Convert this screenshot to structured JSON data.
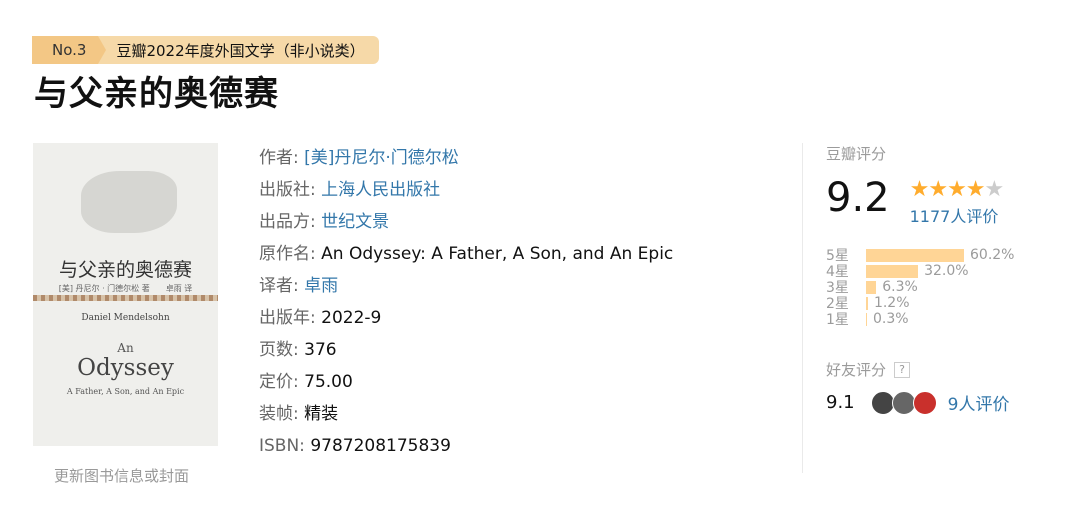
{
  "ranking": {
    "number": "No.3",
    "label": "豆瓣2022年度外国文学（非小说类）"
  },
  "book": {
    "title": "与父亲的奥德赛",
    "cover": {
      "title_cn": "与父亲的奥德赛",
      "author_line": "[美] 丹尼尔 · 门德尔松 著　　卓雨 译",
      "author_en": "Daniel Mendelsohn",
      "an": "An",
      "odyssey": "Odyssey",
      "subtitle": "A Father, A Son, and An Epic"
    },
    "update_link": "更新图书信息或封面"
  },
  "info": {
    "author": {
      "label": "作者:",
      "value": "[美]丹尼尔·门德尔松"
    },
    "publisher": {
      "label": "出版社:",
      "value": "上海人民出版社"
    },
    "producer": {
      "label": "出品方:",
      "value": "世纪文景"
    },
    "original_title": {
      "label": "原作名:",
      "value": "An Odyssey: A Father, A Son, and An Epic"
    },
    "translator": {
      "label": "译者:",
      "value": "卓雨"
    },
    "pub_year": {
      "label": "出版年:",
      "value": "2022-9"
    },
    "pages": {
      "label": "页数:",
      "value": "376"
    },
    "price": {
      "label": "定价:",
      "value": "75.00"
    },
    "binding": {
      "label": "装帧:",
      "value": "精装"
    },
    "isbn": {
      "label": "ISBN:",
      "value": "9787208175839"
    }
  },
  "rating": {
    "title": "豆瓣评分",
    "score": "9.2",
    "stars": "★★★★",
    "stars_half": "★",
    "count": "1177人评价",
    "distribution": [
      {
        "label": "5星",
        "pct": "60.2%",
        "value": 60.2
      },
      {
        "label": "4星",
        "pct": "32.0%",
        "value": 32.0
      },
      {
        "label": "3星",
        "pct": "6.3%",
        "value": 6.3
      },
      {
        "label": "2星",
        "pct": "1.2%",
        "value": 1.2
      },
      {
        "label": "1星",
        "pct": "0.3%",
        "value": 0.3
      }
    ],
    "friend_title": "好友评分",
    "help": "?",
    "friend_score": "9.1",
    "friend_count": "9人评价"
  },
  "colors": {
    "link": "#3377aa",
    "star": "#ffac2d",
    "bar": "#ffd596",
    "ranking_bg": "#f6d9a8"
  }
}
